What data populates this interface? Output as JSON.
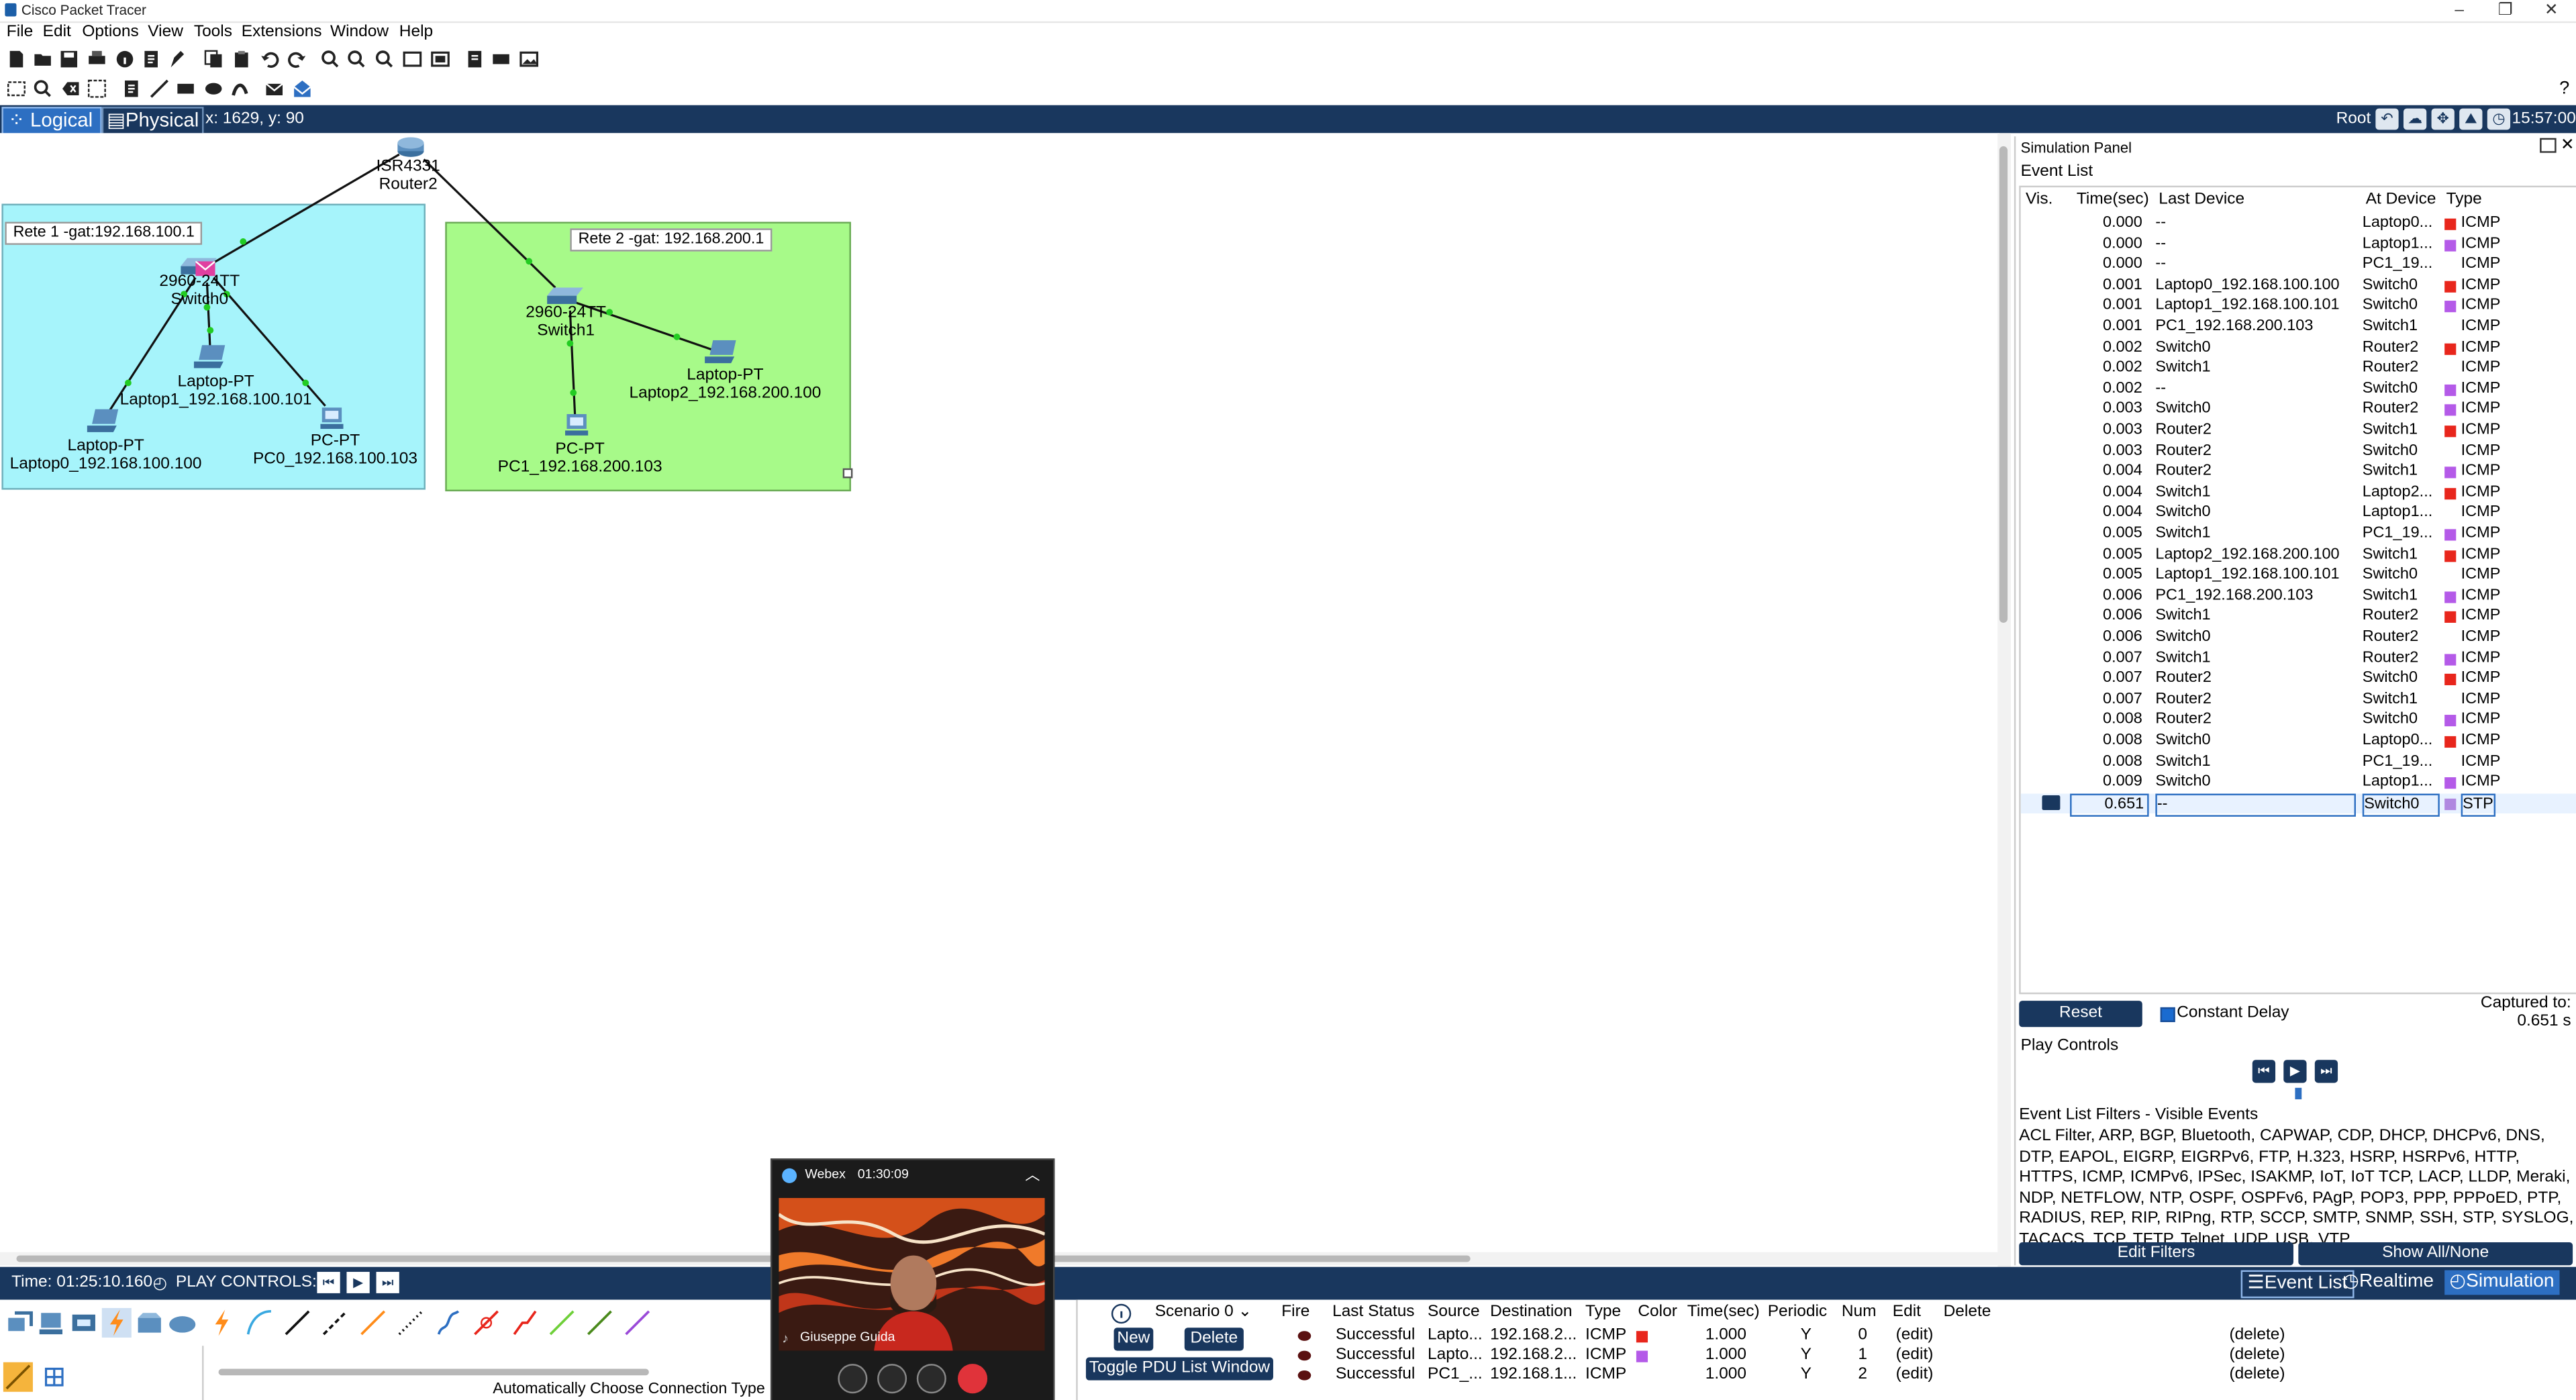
{
  "app": {
    "title": "Cisco Packet Tracer"
  },
  "menu": [
    "File",
    "Edit",
    "Options",
    "View",
    "Tools",
    "Extensions",
    "Window",
    "Help"
  ],
  "modebar": {
    "logical_tab": "Logical",
    "physical_tab": "Physical",
    "coords": "x: 1629, y: 90",
    "root": "Root",
    "clock": "15:57:00"
  },
  "workspace": {
    "rete1_label": "Rete 1 -gat:192.168.100.1",
    "rete2_label": "Rete 2 -gat: 192.168.200.1",
    "router": {
      "model": "ISR4331",
      "name": "Router2"
    },
    "switch0": {
      "model": "2960-24TT",
      "name": "Switch0"
    },
    "switch1": {
      "model": "2960-24TT",
      "name": "Switch1"
    },
    "laptop0": {
      "model": "Laptop-PT",
      "name": "Laptop0_192.168.100.100"
    },
    "laptop1": {
      "model": "Laptop-PT",
      "name": "Laptop1_192.168.100.101"
    },
    "pc0": {
      "model": "PC-PT",
      "name": "PC0_192.168.100.103"
    },
    "laptop2": {
      "model": "Laptop-PT",
      "name": "Laptop2_192.168.200.100"
    },
    "pc1": {
      "model": "PC-PT",
      "name": "PC1_192.168.200.103"
    }
  },
  "sim_panel": {
    "title": "Simulation Panel",
    "event_list_label": "Event List",
    "headers": {
      "vis": "Vis.",
      "time": "Time(sec)",
      "last_device": "Last Device",
      "at_device": "At Device",
      "type": "Type"
    },
    "events": [
      {
        "time": "0.000",
        "last": "--",
        "at": "Laptop0...",
        "color": "#e8261c",
        "type": "ICMP"
      },
      {
        "time": "0.000",
        "last": "--",
        "at": "Laptop1...",
        "color": "#b45ae8",
        "type": "ICMP"
      },
      {
        "time": "0.000",
        "last": "--",
        "at": "PC1_19...",
        "color": "",
        "type": "ICMP"
      },
      {
        "time": "0.001",
        "last": "Laptop0_192.168.100.100",
        "at": "Switch0",
        "color": "#e8261c",
        "type": "ICMP"
      },
      {
        "time": "0.001",
        "last": "Laptop1_192.168.100.101",
        "at": "Switch0",
        "color": "#b45ae8",
        "type": "ICMP"
      },
      {
        "time": "0.001",
        "last": "PC1_192.168.200.103",
        "at": "Switch1",
        "color": "",
        "type": "ICMP"
      },
      {
        "time": "0.002",
        "last": "Switch0",
        "at": "Router2",
        "color": "#e8261c",
        "type": "ICMP"
      },
      {
        "time": "0.002",
        "last": "Switch1",
        "at": "Router2",
        "color": "",
        "type": "ICMP"
      },
      {
        "time": "0.002",
        "last": "--",
        "at": "Switch0",
        "color": "#b45ae8",
        "type": "ICMP"
      },
      {
        "time": "0.003",
        "last": "Switch0",
        "at": "Router2",
        "color": "#b45ae8",
        "type": "ICMP"
      },
      {
        "time": "0.003",
        "last": "Router2",
        "at": "Switch1",
        "color": "#e8261c",
        "type": "ICMP"
      },
      {
        "time": "0.003",
        "last": "Router2",
        "at": "Switch0",
        "color": "",
        "type": "ICMP"
      },
      {
        "time": "0.004",
        "last": "Router2",
        "at": "Switch1",
        "color": "#b45ae8",
        "type": "ICMP"
      },
      {
        "time": "0.004",
        "last": "Switch1",
        "at": "Laptop2...",
        "color": "#e8261c",
        "type": "ICMP"
      },
      {
        "time": "0.004",
        "last": "Switch0",
        "at": "Laptop1...",
        "color": "",
        "type": "ICMP"
      },
      {
        "time": "0.005",
        "last": "Switch1",
        "at": "PC1_19...",
        "color": "#b45ae8",
        "type": "ICMP"
      },
      {
        "time": "0.005",
        "last": "Laptop2_192.168.200.100",
        "at": "Switch1",
        "color": "#e8261c",
        "type": "ICMP"
      },
      {
        "time": "0.005",
        "last": "Laptop1_192.168.100.101",
        "at": "Switch0",
        "color": "",
        "type": "ICMP"
      },
      {
        "time": "0.006",
        "last": "PC1_192.168.200.103",
        "at": "Switch1",
        "color": "#b45ae8",
        "type": "ICMP"
      },
      {
        "time": "0.006",
        "last": "Switch1",
        "at": "Router2",
        "color": "#e8261c",
        "type": "ICMP"
      },
      {
        "time": "0.006",
        "last": "Switch0",
        "at": "Router2",
        "color": "",
        "type": "ICMP"
      },
      {
        "time": "0.007",
        "last": "Switch1",
        "at": "Router2",
        "color": "#b45ae8",
        "type": "ICMP"
      },
      {
        "time": "0.007",
        "last": "Router2",
        "at": "Switch0",
        "color": "#e8261c",
        "type": "ICMP"
      },
      {
        "time": "0.007",
        "last": "Router2",
        "at": "Switch1",
        "color": "",
        "type": "ICMP"
      },
      {
        "time": "0.008",
        "last": "Router2",
        "at": "Switch0",
        "color": "#b45ae8",
        "type": "ICMP"
      },
      {
        "time": "0.008",
        "last": "Switch0",
        "at": "Laptop0...",
        "color": "#e8261c",
        "type": "ICMP"
      },
      {
        "time": "0.008",
        "last": "Switch1",
        "at": "PC1_19...",
        "color": "",
        "type": "ICMP"
      },
      {
        "time": "0.009",
        "last": "Switch0",
        "at": "Laptop1...",
        "color": "#b45ae8",
        "type": "ICMP"
      },
      {
        "time": "0.651",
        "last": "--",
        "at": "Switch0",
        "color": "#b088e0",
        "type": "STP"
      }
    ],
    "reset_button": "Reset Simulation",
    "constant_delay": "Constant Delay",
    "captured_label": "Captured to:",
    "captured_value": "0.651 s",
    "play_controls": "Play Controls",
    "filters_label": "Event List Filters - Visible Events",
    "filters_text": "ACL Filter, ARP, BGP, Bluetooth, CAPWAP, CDP, DHCP, DHCPv6, DNS, DTP, EAPOL, EIGRP, EIGRPv6, FTP, H.323, HSRP, HSRPv6, HTTP, HTTPS, ICMP, ICMPv6, IPSec, ISAKMP, IoT, IoT TCP, LACP, LLDP, Meraki, NDP, NETFLOW, NTP, OSPF, OSPFv6, PAgP, POP3, PPP, PPPoED, PTP, RADIUS, REP, RIP, RIPng, RTP, SCCP, SMTP, SNMP, SSH, STP, SYSLOG, TACACS, TCP, TFTP, Telnet, UDP, USB, VTP",
    "edit_filters": "Edit Filters",
    "show_all": "Show All/None"
  },
  "bottombar": {
    "time": "Time: 01:25:10.160",
    "play_controls": "PLAY CONTROLS:",
    "event_list": "Event List",
    "realtime": "Realtime",
    "simulation": "Simulation"
  },
  "palette": {
    "conn_hint": "Automatically Choose Connection Type"
  },
  "pdu": {
    "scenario": "Scenario 0",
    "new": "New",
    "delete": "Delete",
    "toggle": "Toggle PDU List Window",
    "headers": [
      "Fire",
      "Last Status",
      "Source",
      "Destination",
      "Type",
      "Color",
      "Time(sec)",
      "Periodic",
      "Num",
      "Edit",
      "Delete"
    ],
    "rows": [
      {
        "status": "Successful",
        "source": "Lapto...",
        "dest": "192.168.2...",
        "type": "ICMP",
        "color": "#e8261c",
        "time": "1.000",
        "periodic": "Y",
        "num": "0",
        "edit": "(edit)",
        "delete": "(delete)"
      },
      {
        "status": "Successful",
        "source": "Lapto...",
        "dest": "192.168.2...",
        "type": "ICMP",
        "color": "#b45ae8",
        "time": "1.000",
        "periodic": "Y",
        "num": "1",
        "edit": "(edit)",
        "delete": "(delete)"
      },
      {
        "status": "Successful",
        "source": "PC1_...",
        "dest": "192.168.1...",
        "type": "ICMP",
        "color": "",
        "time": "1.000",
        "periodic": "Y",
        "num": "2",
        "edit": "(edit)",
        "delete": "(delete)"
      }
    ]
  },
  "webex": {
    "title": "Webex",
    "time": "01:30:09",
    "participant": "Giuseppe Guida"
  }
}
